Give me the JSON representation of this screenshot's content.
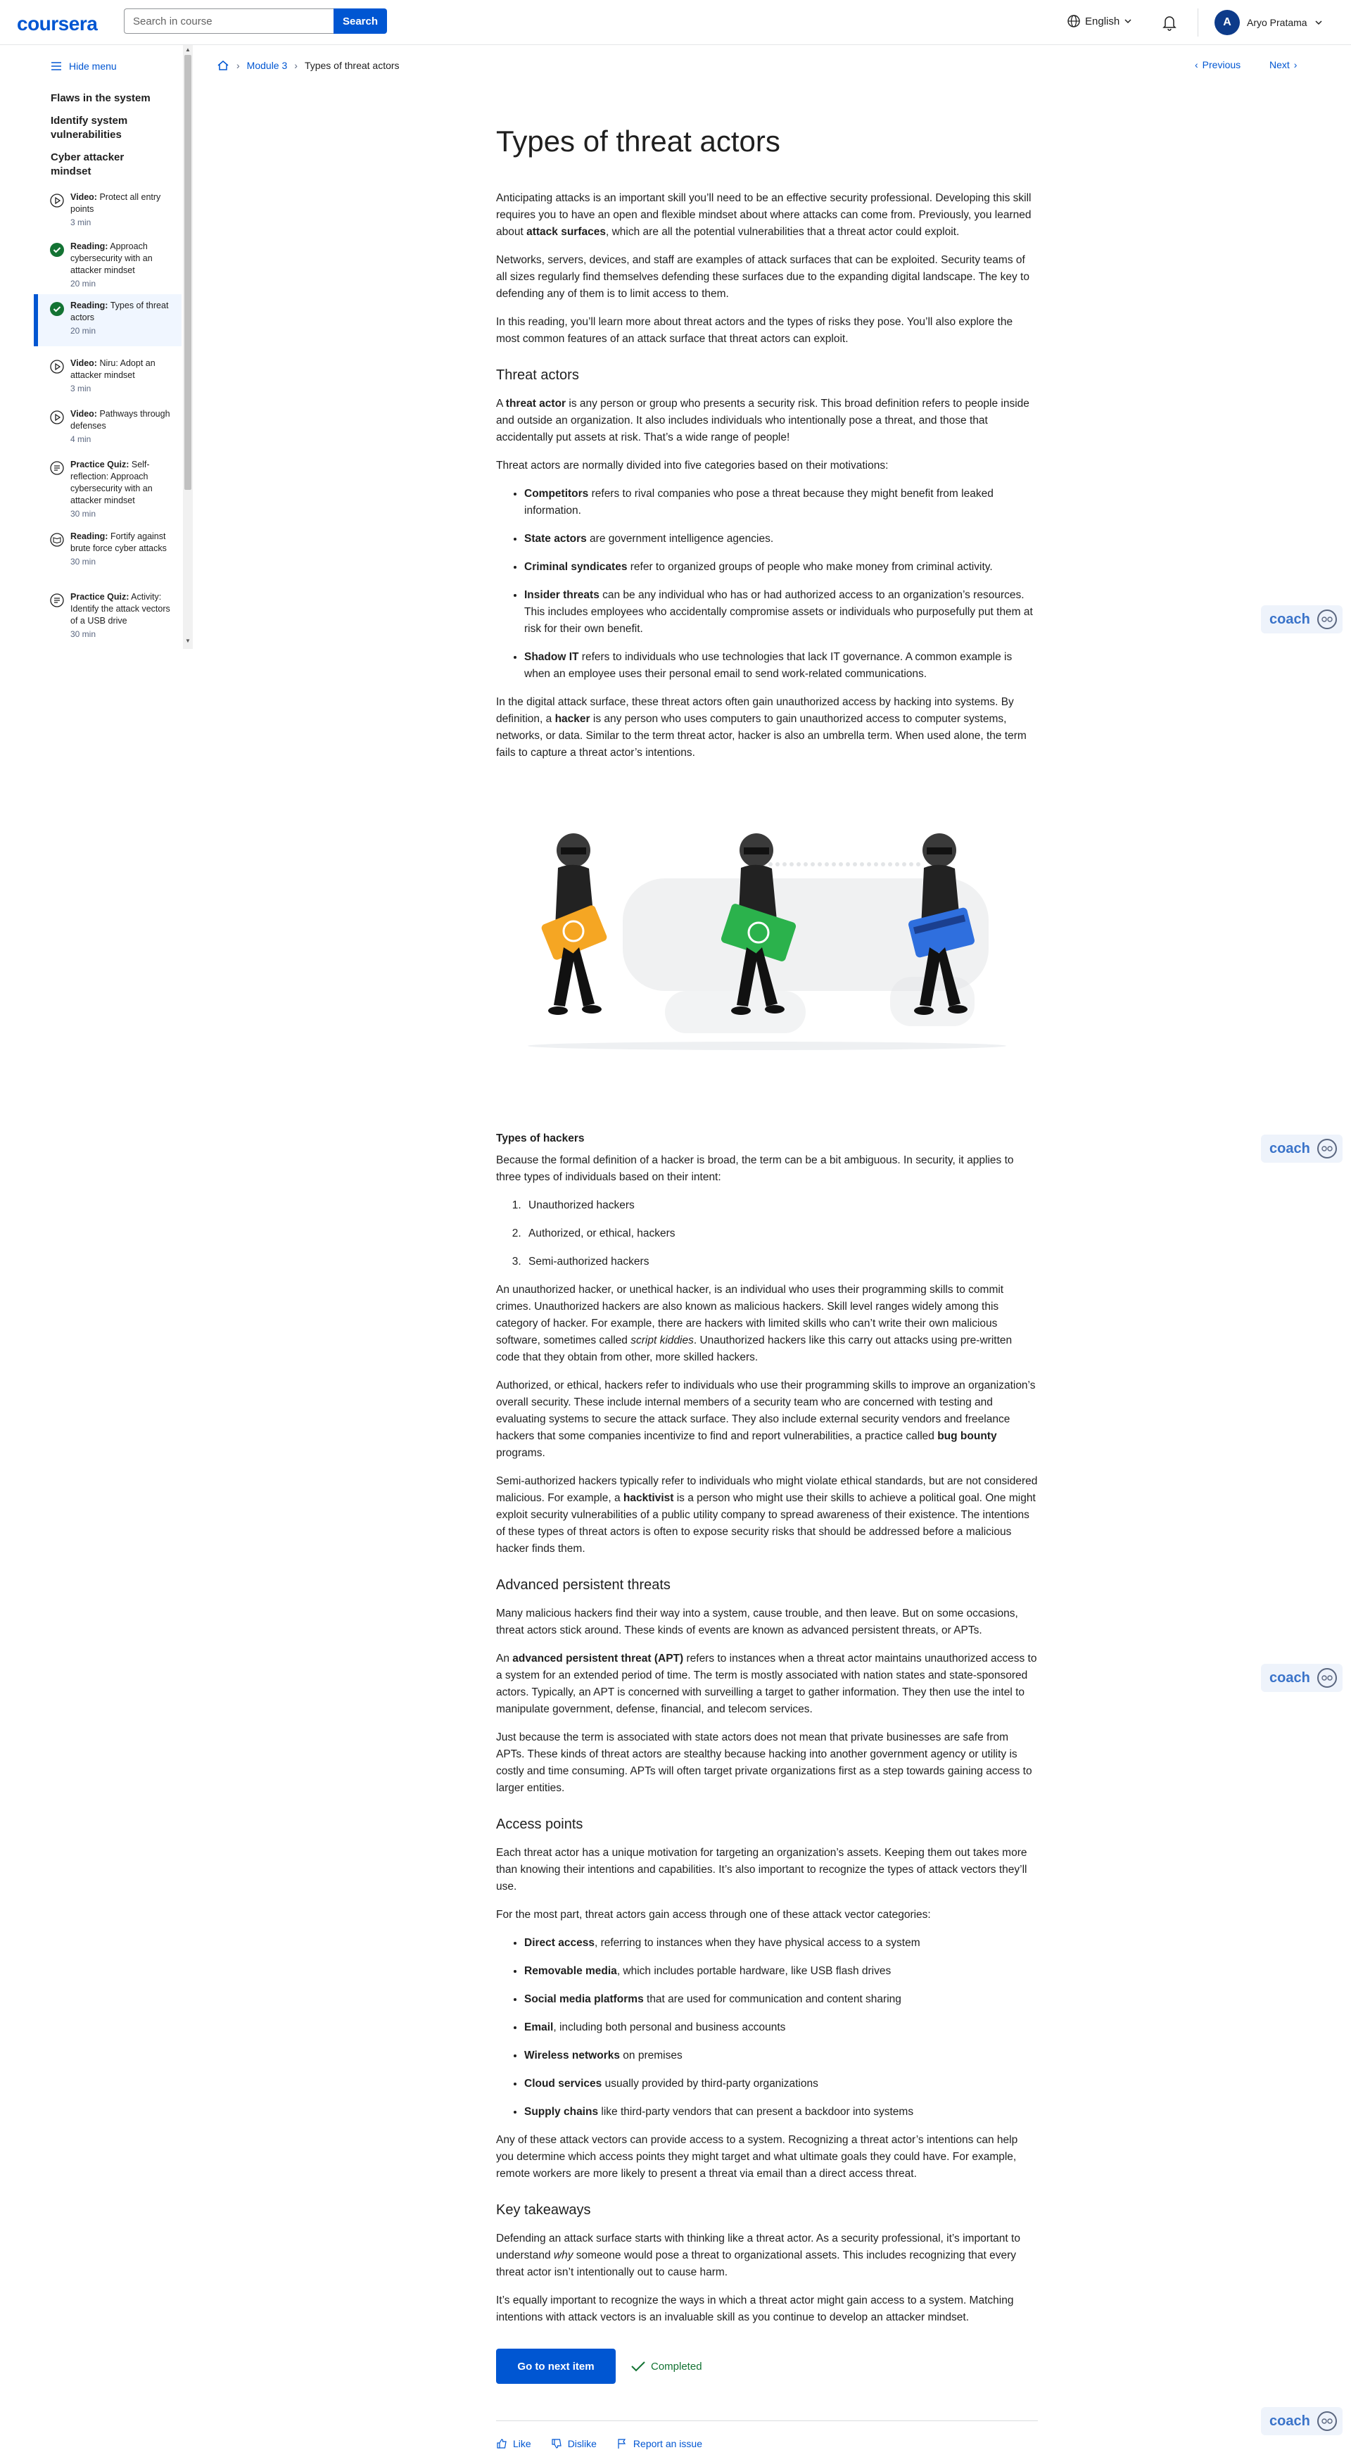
{
  "header": {
    "logo": "coursera",
    "search_placeholder": "Search in course",
    "search_button": "Search",
    "language": "English",
    "user_initial": "A",
    "user_name": "Aryo Pratama"
  },
  "sidebar": {
    "hide_menu": "Hide menu",
    "modules": [
      "Flaws in the system",
      "Identify system vulnerabilities",
      "Cyber attacker mindset"
    ],
    "items": [
      {
        "type": "Video:",
        "title": "Protect all entry points",
        "duration": "3 min",
        "status": "video"
      },
      {
        "type": "Reading:",
        "title": "Approach cybersecurity with an attacker mindset",
        "duration": "20 min",
        "status": "done"
      },
      {
        "type": "Reading:",
        "title": "Types of threat actors",
        "duration": "20 min",
        "status": "done"
      },
      {
        "type": "Video:",
        "title": "Niru: Adopt an attacker mindset",
        "duration": "3 min",
        "status": "video"
      },
      {
        "type": "Video:",
        "title": "Pathways through defenses",
        "duration": "4 min",
        "status": "video"
      },
      {
        "type": "Practice Quiz:",
        "title": "Self-reflection: Approach cybersecurity with an attacker mindset",
        "duration": "30 min",
        "status": "quiz"
      },
      {
        "type": "Reading:",
        "title": "Fortify against brute force cyber attacks",
        "duration": "30 min",
        "status": "reading"
      },
      {
        "type": "Practice Quiz:",
        "title": "Activity: Identify the attack vectors of a USB drive",
        "duration": "30 min",
        "status": "quiz"
      }
    ]
  },
  "breadcrumb": {
    "module": "Module 3",
    "current": "Types of threat actors"
  },
  "pager": {
    "previous": "Previous",
    "next": "Next"
  },
  "article": {
    "title": "Types of threat actors",
    "intro_p1_a": "Anticipating attacks is an important skill you’ll need to be an effective security professional. Developing this skill requires you to have an open and flexible mindset about where attacks can come from. Previously, you learned about ",
    "intro_p1_b": "attack surfaces",
    "intro_p1_c": ", which are all the potential vulnerabilities that a threat actor could exploit.",
    "intro_p2": "Networks, servers, devices, and staff are examples of attack surfaces that can be exploited. Security teams of all sizes regularly find themselves defending these surfaces due to the expanding digital landscape. The key to defending any of them is to limit access to them.",
    "intro_p3": "In this reading, you’ll learn more about threat actors and the types of risks they pose. You’ll also explore the most common features of an attack surface that threat actors can exploit.",
    "h_threat_actors": "Threat actors",
    "ta_p1_a": "A ",
    "ta_p1_b": "threat actor",
    "ta_p1_c": " is any person or group who presents a security risk. This broad definition refers to people inside and outside an organization. It also includes individuals who intentionally pose a threat, and those that accidentally put assets at risk. That’s a wide range of people!",
    "ta_p2": "Threat actors are normally divided into five categories based on their motivations:",
    "categories": [
      {
        "term": "Competitors",
        "desc": " refers to rival companies who pose a threat because they might benefit from leaked information."
      },
      {
        "term": "State actors",
        "desc": " are government intelligence agencies."
      },
      {
        "term": "Criminal syndicates",
        "desc": " refer to organized groups of people who make money from criminal activity."
      },
      {
        "term": "Insider threats",
        "desc": " can be any individual who has or had authorized access to an organization’s resources. This includes employees who accidentally compromise assets or individuals who purposefully put them at risk for their own benefit."
      },
      {
        "term": "Shadow IT",
        "desc": " refers to individuals who use technologies that lack IT governance. A common example is when an employee uses their personal email to send work-related communications."
      }
    ],
    "ta_p3_a": "In the digital attack surface, these threat actors often gain unauthorized access by hacking into systems. By definition, a ",
    "ta_p3_b": "hacker",
    "ta_p3_c": " is any person who uses computers to gain unauthorized access to computer systems, networks, or data. Similar to the term threat actor, hacker is also an umbrella term. When used alone, the term fails to capture a threat actor’s intentions.",
    "h_types_hackers": "Types of hackers",
    "th_p1": "Because the formal definition of a hacker is broad, the term can be a bit ambiguous. In security, it applies to three types of individuals based on their intent:",
    "hacker_types": [
      "Unauthorized hackers",
      "Authorized, or ethical, hackers",
      "Semi-authorized hackers"
    ],
    "th_p2_a": "An unauthorized hacker, or unethical hacker, is an individual who uses their programming skills to commit crimes. Unauthorized hackers are also known as malicious hackers. Skill level ranges widely among this category of hacker. For example, there are hackers with limited skills who can’t write their own malicious software, sometimes called ",
    "th_p2_b": "script kiddies",
    "th_p2_c": ". Unauthorized hackers like this carry out attacks using pre-written code that they obtain from other, more skilled hackers.",
    "th_p3_a": "Authorized, or ethical, hackers refer to individuals who use their programming skills to improve an organization’s overall security. These include internal members of a security team who are concerned with testing and evaluating systems to secure the attack surface. They also include external security vendors and freelance hackers that some companies incentivize to find and report vulnerabilities, a practice called ",
    "th_p3_b": "bug bounty",
    "th_p3_c": " programs.",
    "th_p4_a": "Semi-authorized hackers typically refer to individuals who might violate ethical standards, but are not considered malicious. For example, a ",
    "th_p4_b": "hacktivist",
    "th_p4_c": " is a person who might use their skills to achieve a political goal. One might exploit security vulnerabilities of a public utility company to spread awareness of their existence. The intentions of these types of threat actors is often to expose security risks that should be addressed before a malicious hacker finds them.",
    "h_apt": "Advanced persistent threats",
    "apt_p1": "Many malicious hackers find their way into a system, cause trouble, and then leave. But on some occasions, threat actors stick around. These kinds of events are known as advanced persistent threats, or APTs.",
    "apt_p2_a": "An ",
    "apt_p2_b": "advanced persistent threat (APT)",
    "apt_p2_c": " refers to instances when a threat actor maintains unauthorized access to a system for an extended period of time. The term is mostly associated with nation states and state-sponsored actors. Typically, an APT is concerned with surveilling a target to gather information. They then use the intel to manipulate government, defense, financial, and telecom services.",
    "apt_p3": "Just because the term is associated with state actors does not mean that private businesses are safe from APTs. These kinds of threat actors are stealthy because hacking into another government agency or utility is costly and time consuming. APTs will often target private organizations first as a step towards gaining access to larger entities.",
    "h_access": "Access points",
    "ap_p1": "Each threat actor has a unique motivation for targeting an organization’s assets. Keeping them out takes more than knowing their intentions and capabilities. It’s also important to recognize the types of attack vectors they’ll use.",
    "ap_p2": "For the most part, threat actors gain access through one of these attack vector categories:",
    "vectors": [
      {
        "term": "Direct access",
        "desc": ", referring to instances when they have physical access to a system"
      },
      {
        "term": "Removable media",
        "desc": ", which includes portable hardware, like USB flash drives"
      },
      {
        "term": "Social media platforms",
        "desc": " that are used for communication and content sharing"
      },
      {
        "term": "Email",
        "desc": ", including both personal and business accounts"
      },
      {
        "term": "Wireless networks",
        "desc": " on premises"
      },
      {
        "term": "Cloud services",
        "desc": " usually provided by third-party organizations"
      },
      {
        "term": "Supply chains",
        "desc": " like third-party vendors that can present a backdoor into systems"
      }
    ],
    "ap_p3": "Any of these attack vectors can provide access to a system. Recognizing a threat actor’s intentions can help you determine which access points they might target and what ultimate goals they could have. For example, remote workers are more likely to present a threat via email than a direct access threat.",
    "h_takeaways": "Key takeaways",
    "kt_p1_a": "Defending an attack surface starts with thinking like a threat actor. As a security professional, it’s important to understand ",
    "kt_p1_b": "why",
    "kt_p1_c": " someone would pose a threat to organizational assets. This includes recognizing that every threat actor isn’t intentionally out to cause harm.",
    "kt_p2": "It’s equally important to recognize the ways in which a threat actor might gain access to a system. Matching intentions with attack vectors is an invaluable skill as you continue to develop an attacker mindset."
  },
  "actions": {
    "next_item": "Go to next item",
    "completed": "Completed",
    "like": "Like",
    "dislike": "Dislike",
    "report": "Report an issue"
  },
  "coach": {
    "label": "coach"
  },
  "colors": {
    "brand": "#0056d2",
    "success": "#137333",
    "illus_gold": "#f5a623",
    "illus_green": "#2bb24c",
    "illus_blue": "#2f6fde"
  }
}
